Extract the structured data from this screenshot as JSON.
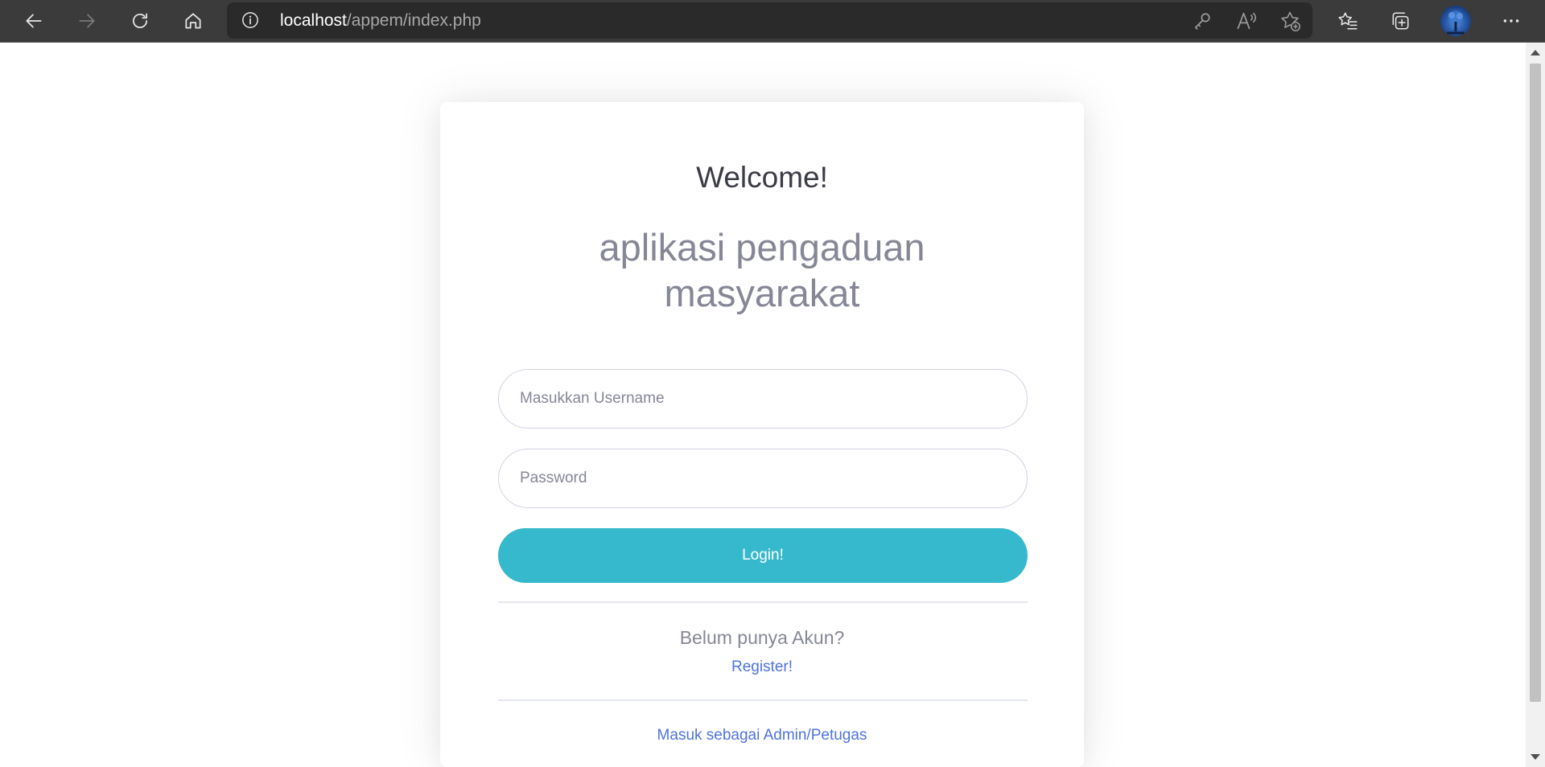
{
  "browser": {
    "url_host": "localhost",
    "url_path": "/appem/index.php",
    "icons": {
      "back": "arrow-left-icon",
      "forward": "arrow-right-icon",
      "refresh": "refresh-icon",
      "home": "home-icon",
      "site_info": "info-icon",
      "password": "key-icon",
      "read_aloud": "read-aloud-icon",
      "add_favorite": "star-plus-icon",
      "favorites": "favorites-list-icon",
      "collections": "collections-icon",
      "profile": "avatar",
      "menu": "more-horizontal-icon"
    }
  },
  "login": {
    "welcome": "Welcome!",
    "app_title_line1": "aplikasi pengaduan",
    "app_title_line2": "masyarakat",
    "username_placeholder": "Masukkan Username",
    "password_placeholder": "Password",
    "login_button": "Login!",
    "no_account_text": "Belum punya Akun?",
    "register_link": "Register!",
    "admin_link": "Masuk sebagai Admin/Petugas"
  },
  "colors": {
    "login_button": "#36b9cc",
    "link": "#4e73df",
    "muted_text": "#858796",
    "heading_text": "#3a3b45",
    "browser_toolbar": "#3b3b3b"
  }
}
